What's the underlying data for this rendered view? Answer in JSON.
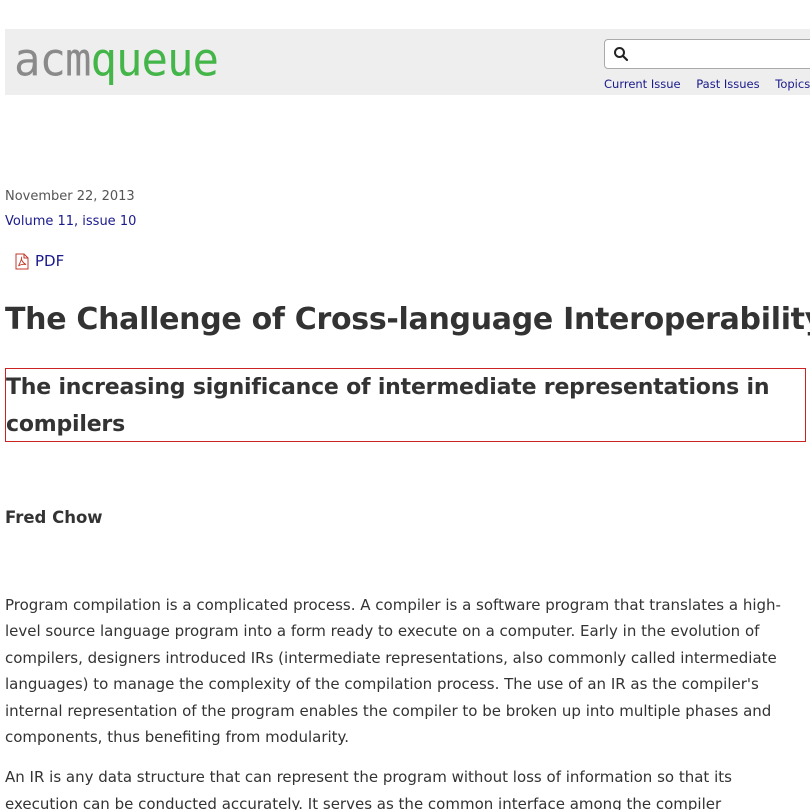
{
  "header": {
    "logo_acm": "acm",
    "logo_queue": "queue",
    "search_placeholder": "",
    "nav": [
      "Current Issue",
      "Past Issues",
      "Topics"
    ]
  },
  "article": {
    "date": "November 22, 2013",
    "volume": "Volume 11, issue 10",
    "pdf_label": "PDF",
    "title": "The Challenge of Cross-language Interoperability",
    "subtitle": "The increasing significance of intermediate representations in compilers",
    "author": "Fred Chow",
    "paragraphs": [
      "Program compilation is a complicated process. A compiler is a software program that translates a high-level source language program into a form ready to execute on a computer. Early in the evolution of compilers, designers introduced IRs (intermediate representations, also commonly called intermediate languages) to manage the complexity of the compilation process. The use of an IR as the compiler's internal representation of the program enables the compiler to be broken up into multiple phases and components, thus benefiting from modularity.",
      "An IR is any data structure that can represent the program without loss of information so that its execution can be conducted accurately. It serves as the common interface among the compiler"
    ]
  },
  "colors": {
    "accent_green": "#44b649",
    "logo_gray": "#8a8a8a",
    "link_blue": "#1a1a8c",
    "highlight_border": "#cc2222"
  },
  "icons": {
    "search": "magnifier-icon",
    "pdf": "pdf-icon"
  }
}
